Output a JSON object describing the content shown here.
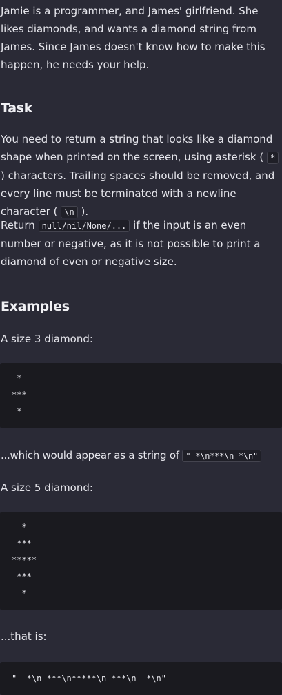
{
  "intro": {
    "text": "Jamie is a programmer, and James' girlfriend. She likes diamonds, and wants a diamond string from James. Since James doesn't know how to make this happen, he needs your help."
  },
  "task": {
    "heading": "Task",
    "p1_a": "You need to return a string that looks like a diamond shape when printed on the screen, using asterisk (",
    "p1_code1": "*",
    "p1_b": ") characters. Trailing spaces should be removed, and every line must be terminated with a newline character (",
    "p1_code2": "\\n",
    "p1_c": ").",
    "p2_a": "Return",
    "p2_code": "null/nil/None/...",
    "p2_b": "if the input is an even number or negative, as it is not possible to print a diamond of even or negative size."
  },
  "examples": {
    "heading": "Examples",
    "size3_label": "A size 3 diamond:",
    "size3_block": " *\n***\n *",
    "size3_after_a": "...which would appear as a string of",
    "size3_after_code": "\" *\\n***\\n *\\n\"",
    "size5_label": "A size 5 diamond:",
    "size5_block": "  *\n ***\n*****\n ***\n  *",
    "size5_after": "...that is:",
    "size5_string_block": "\"  *\\n ***\\n*****\\n ***\\n  *\\n\""
  }
}
